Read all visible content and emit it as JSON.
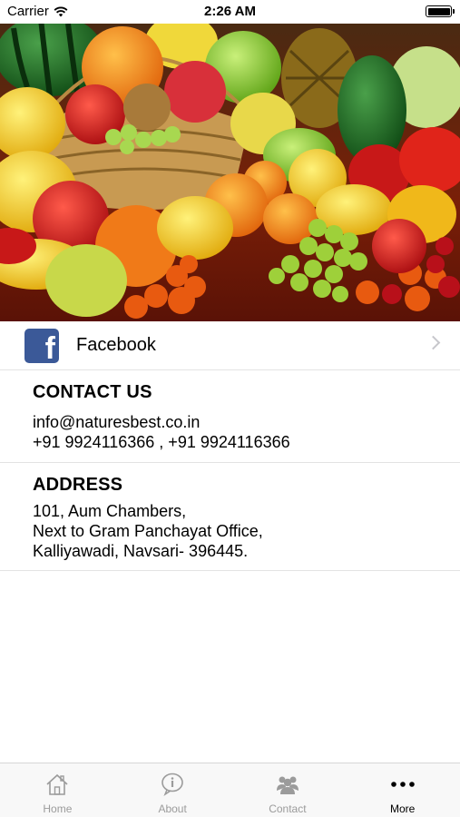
{
  "status_bar": {
    "carrier": "Carrier",
    "time": "2:26 AM"
  },
  "facebook": {
    "label": "Facebook",
    "icon": "facebook-icon"
  },
  "contact": {
    "heading": "CONTACT US",
    "email": "info@naturesbest.co.in",
    "phones": "+91 9924116366 , +91 9924116366"
  },
  "address": {
    "heading": "ADDRESS",
    "line1": "101, Aum Chambers,",
    "line2": "Next to Gram Panchayat Office,",
    "line3": "Kalliyawadi, Navsari- 396445."
  },
  "tabs": [
    {
      "label": "Home",
      "icon": "home-icon"
    },
    {
      "label": "About",
      "icon": "info-icon"
    },
    {
      "label": "Contact",
      "icon": "people-icon"
    },
    {
      "label": "More",
      "icon": "more-icon"
    }
  ],
  "colors": {
    "facebook_blue": "#3b5998",
    "tab_inactive": "#9b9b9b",
    "tab_active": "#000000"
  }
}
